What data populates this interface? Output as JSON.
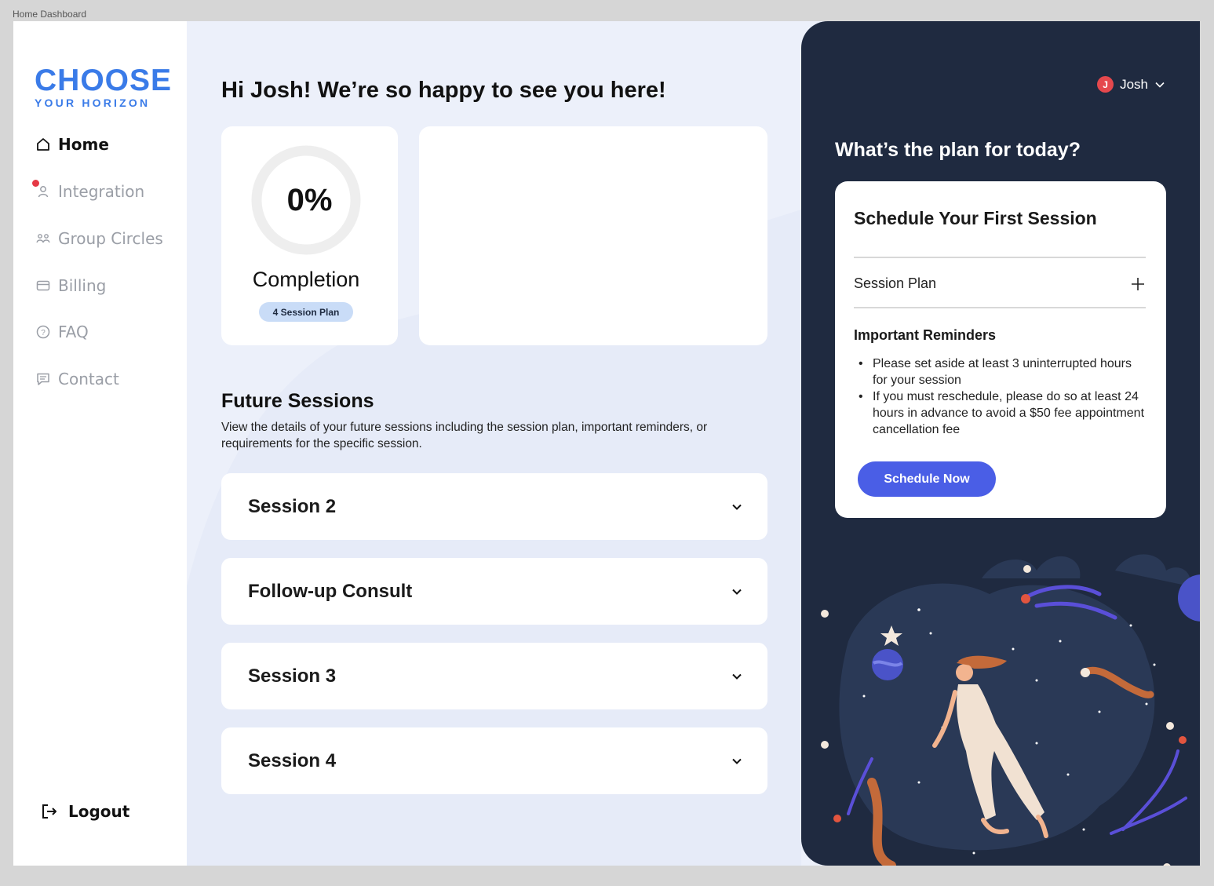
{
  "frame_label": "Home Dashboard",
  "logo": {
    "main": "CHOOSE",
    "sub": "YOUR HORIZON"
  },
  "nav": [
    {
      "label": "Home",
      "icon": "home-icon",
      "active": true
    },
    {
      "label": "Integration",
      "icon": "user-icon",
      "notification": true
    },
    {
      "label": "Group Circles",
      "icon": "group-icon"
    },
    {
      "label": "Billing",
      "icon": "credit-card-icon"
    },
    {
      "label": "FAQ",
      "icon": "question-icon"
    },
    {
      "label": "Contact",
      "icon": "chat-icon"
    }
  ],
  "logout_label": "Logout",
  "greeting": "Hi Josh! We’re so happy to see you here!",
  "completion": {
    "percent": "0%",
    "label": "Completion",
    "badge": "4 Session Plan",
    "progress": 0
  },
  "future_sessions": {
    "title": "Future Sessions",
    "description": "View the details of your future sessions including the session plan, important reminders, or requirements for the specific session.",
    "items": [
      "Session 2",
      "Follow-up Consult",
      "Session 3",
      "Session 4"
    ]
  },
  "user": {
    "initial": "J",
    "name": "Josh"
  },
  "plan_question": "What’s the plan for today?",
  "schedule_card": {
    "title": "Schedule Your First Session",
    "session_plan_label": "Session Plan",
    "reminders_title": "Important Reminders",
    "reminders": [
      "Please set aside at least 3 uninterrupted hours for your session",
      "If you must reschedule, please do so at least 24 hours in advance to avoid a $50 fee appointment cancellation fee"
    ],
    "button_label": "Schedule Now"
  },
  "colors": {
    "brand": "#3a7be8",
    "panel_dark": "#1f2a40",
    "button": "#4a5ee6",
    "badge": "#c9dcf7",
    "notification": "#e53945",
    "background": "#ecf0fa"
  }
}
